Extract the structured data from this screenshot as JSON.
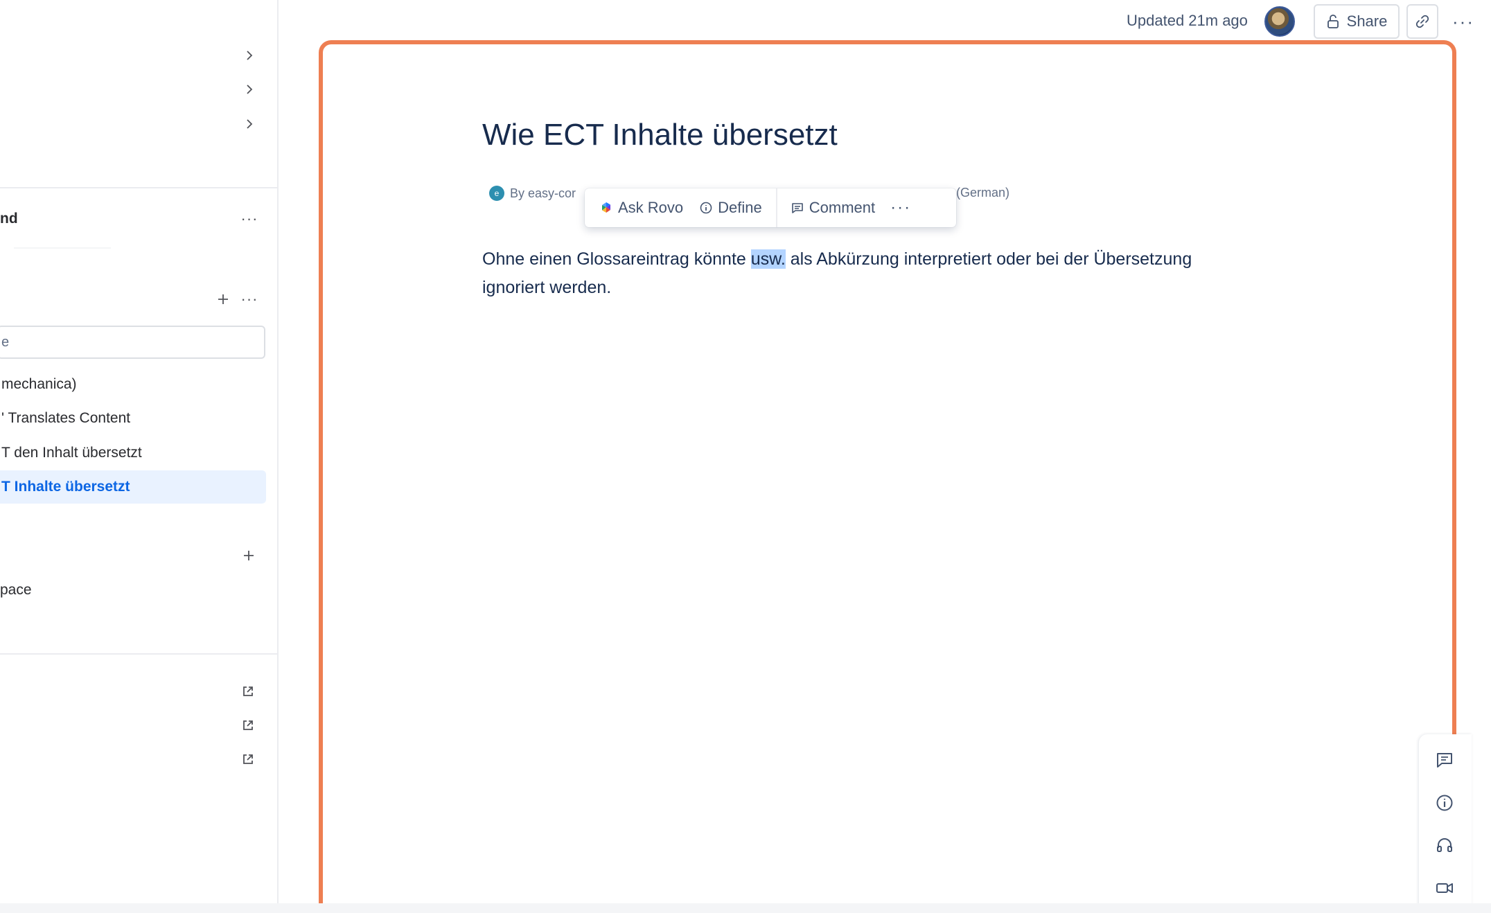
{
  "sidebar": {
    "partial_item_1": "nd",
    "search_placeholder": "e",
    "tree_items": [
      {
        "label": "mechanica)",
        "active": false
      },
      {
        "label": "' Translates Content",
        "active": false
      },
      {
        "label": "T den Inhalt übersetzt",
        "active": false
      },
      {
        "label": "T Inhalte übersetzt",
        "active": true
      }
    ],
    "partial_item_2": "pace"
  },
  "topbar": {
    "updated": "Updated 21m ago",
    "share_label": "Share"
  },
  "page": {
    "title": "Wie ECT Inhalte übersetzt",
    "byline_author": "By easy-cor",
    "byline_lang": "(German)",
    "body_before": "Ohne einen Glossareintrag könnte ",
    "body_selected": "usw.",
    "body_after": " als Abkürzung interpretiert oder bei der Übersetzung ignoriert werden."
  },
  "selection_toolbar": {
    "ask_rovo": "Ask Rovo",
    "define": "Define",
    "comment": "Comment"
  },
  "colors": {
    "frame_border": "#ee7f52",
    "selection_highlight": "#b3d4ff",
    "active_item_bg": "#e9f2ff",
    "active_item_text": "#0c66e4"
  }
}
